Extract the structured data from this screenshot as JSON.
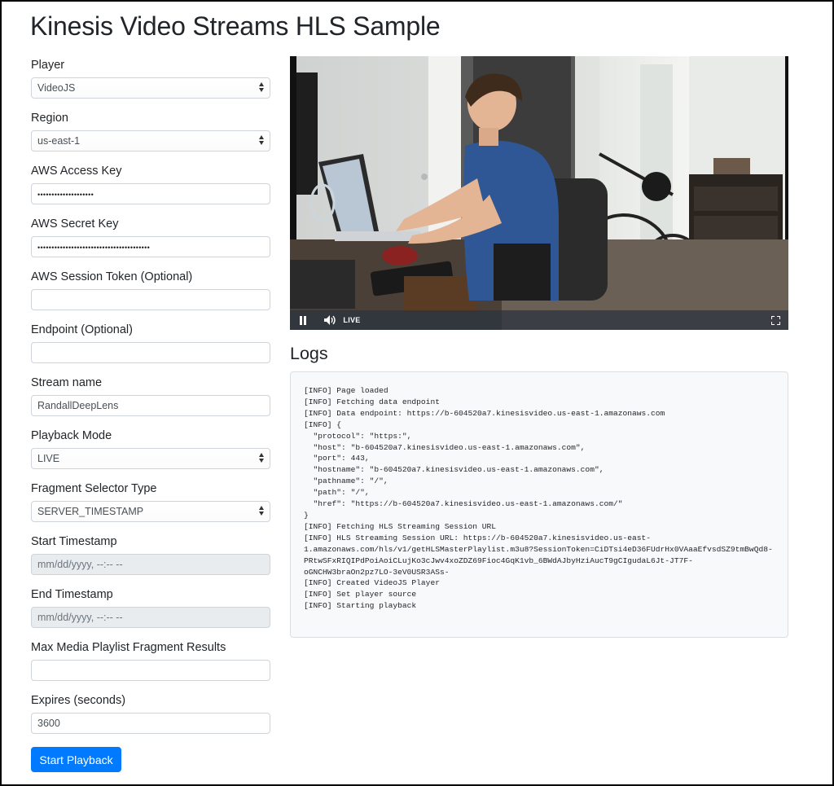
{
  "page": {
    "title": "Kinesis Video Streams HLS Sample"
  },
  "form": {
    "player": {
      "label": "Player",
      "value": "VideoJS"
    },
    "region": {
      "label": "Region",
      "value": "us-east-1"
    },
    "access_key": {
      "label": "AWS Access Key",
      "value": "••••••••••••••••••••"
    },
    "secret_key": {
      "label": "AWS Secret Key",
      "value": "••••••••••••••••••••••••••••••••••••••••"
    },
    "session_token": {
      "label": "AWS Session Token (Optional)",
      "value": ""
    },
    "endpoint": {
      "label": "Endpoint (Optional)",
      "value": ""
    },
    "stream_name": {
      "label": "Stream name",
      "value": "RandallDeepLens"
    },
    "playback_mode": {
      "label": "Playback Mode",
      "value": "LIVE"
    },
    "fragment_selector": {
      "label": "Fragment Selector Type",
      "value": "SERVER_TIMESTAMP"
    },
    "start_timestamp": {
      "label": "Start Timestamp",
      "placeholder": "mm/dd/yyyy, --:-- --"
    },
    "end_timestamp": {
      "label": "End Timestamp",
      "placeholder": "mm/dd/yyyy, --:-- --"
    },
    "max_results": {
      "label": "Max Media Playlist Fragment Results",
      "value": ""
    },
    "expires": {
      "label": "Expires (seconds)",
      "value": "3600"
    },
    "submit_label": "Start Playback"
  },
  "player": {
    "live_label": "LIVE",
    "icons": {
      "play_pause": "pause-icon",
      "volume": "volume-icon",
      "fullscreen": "fullscreen-icon"
    }
  },
  "logs": {
    "heading": "Logs",
    "text": "[INFO] Page loaded\n[INFO] Fetching data endpoint\n[INFO] Data endpoint: https://b-604520a7.kinesisvideo.us-east-1.amazonaws.com\n[INFO] {\n  \"protocol\": \"https:\",\n  \"host\": \"b-604520a7.kinesisvideo.us-east-1.amazonaws.com\",\n  \"port\": 443,\n  \"hostname\": \"b-604520a7.kinesisvideo.us-east-1.amazonaws.com\",\n  \"pathname\": \"/\",\n  \"path\": \"/\",\n  \"href\": \"https://b-604520a7.kinesisvideo.us-east-1.amazonaws.com/\"\n}\n[INFO] Fetching HLS Streaming Session URL\n[INFO] HLS Streaming Session URL: https://b-604520a7.kinesisvideo.us-east-\n1.amazonaws.com/hls/v1/getHLSMasterPlaylist.m3u8?SessionToken=CiDTsi4eD36FUdrHx0VAaaEfvsdSZ9tmBwQd8-\nPRtwSFxRIQIPdPoiAoiCLujKo3cJwv4xoZDZ69Fioc4GqK1vb_6BWdAJbyHziAucT9gCIgudaL6Jt-JT7F-\noGNCHW3braOn2pz7LO-3eV0USR3ASs-\n[INFO] Created VideoJS Player\n[INFO] Set player source\n[INFO] Starting playback"
  },
  "colors": {
    "primary": "#007bff",
    "border": "#ced4da",
    "disabled_bg": "#e9ecef",
    "logs_bg": "#f8f9fa"
  }
}
